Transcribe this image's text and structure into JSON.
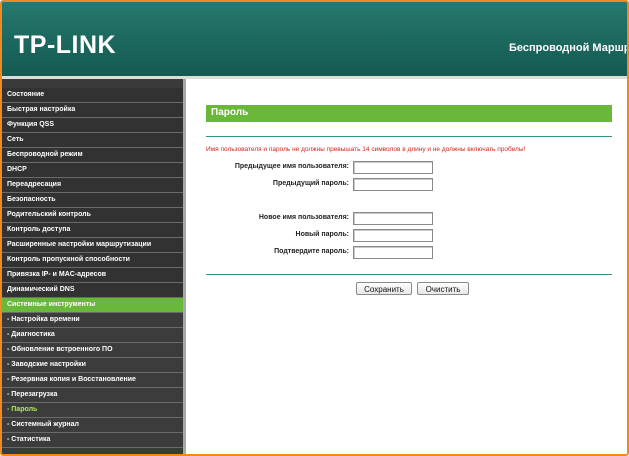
{
  "header": {
    "logo": "TP-LINK",
    "title": "Беспроводной Маршру"
  },
  "sidebar": {
    "items": [
      {
        "label": "Состояние"
      },
      {
        "label": "Быстрая настройка"
      },
      {
        "label": "Функция QSS"
      },
      {
        "label": "Сеть"
      },
      {
        "label": "Беспроводной режим"
      },
      {
        "label": "DHCP"
      },
      {
        "label": "Переадресация"
      },
      {
        "label": "Безопасность"
      },
      {
        "label": "Родительский контроль"
      },
      {
        "label": "Контроль доступа"
      },
      {
        "label": "Расширенные настройки маршрутизации"
      },
      {
        "label": "Контроль пропускной способности"
      },
      {
        "label": "Привязка IP- и MAC-адресов"
      },
      {
        "label": "Динамический DNS"
      },
      {
        "label": "Системные инструменты"
      },
      {
        "label": "- Настройка времени"
      },
      {
        "label": "- Диагностика"
      },
      {
        "label": "- Обновление встроенного ПО"
      },
      {
        "label": "- Заводские настройки"
      },
      {
        "label": "- Резервная копия и Восстановление"
      },
      {
        "label": "- Перезагрузка"
      },
      {
        "label": "- Пароль"
      },
      {
        "label": "- Системный журнал"
      },
      {
        "label": "- Статистика"
      }
    ]
  },
  "main": {
    "section_title": "Пароль",
    "warning": "Имя пользователя и пароль не должны превышать 14 символов в длину и не должны включать пробелы!",
    "fields": {
      "old_username": {
        "label": "Предыдущее имя пользователя:",
        "value": ""
      },
      "old_password": {
        "label": "Предыдущий пароль:",
        "value": ""
      },
      "new_username": {
        "label": "Новое имя пользователя:",
        "value": ""
      },
      "new_password": {
        "label": "Новый пароль:",
        "value": ""
      },
      "confirm_password": {
        "label": "Подтвердите пароль:",
        "value": ""
      }
    },
    "buttons": {
      "save": "Сохранить",
      "clear": "Очистить"
    }
  },
  "colors": {
    "accent_green": "#6ab83a",
    "header_teal": "#1d6a61",
    "warning_red": "#d8231b",
    "frame_orange": "#ef8a1e",
    "sidebar_dark": "#323232"
  }
}
